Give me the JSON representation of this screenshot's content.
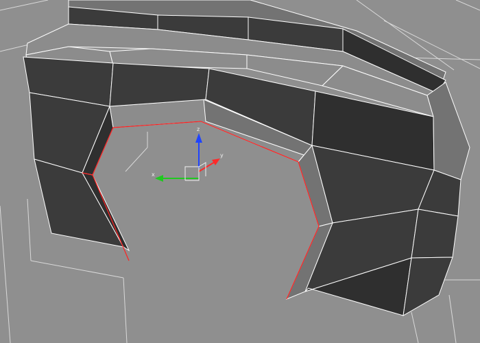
{
  "viewport": {
    "gizmo": {
      "x_label": "x",
      "y_label": "y",
      "z_label": "z"
    }
  }
}
